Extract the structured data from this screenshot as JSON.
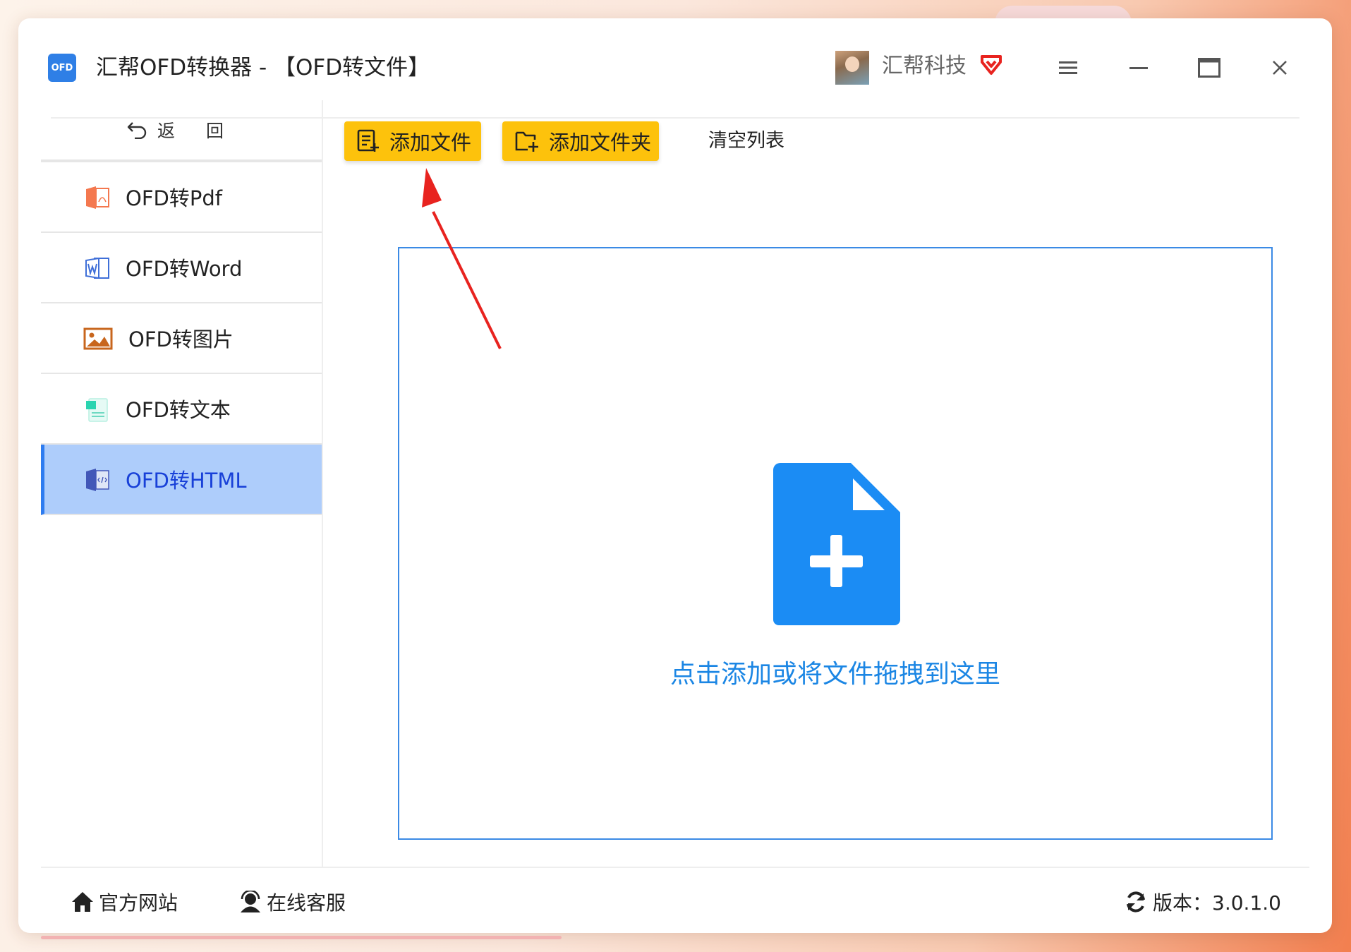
{
  "window": {
    "logo_text": "OFD",
    "title": "汇帮OFD转换器 - 【OFD转文件】",
    "brand": "汇帮科技"
  },
  "sidebar": {
    "back_label": "返 回",
    "items": [
      {
        "label": "OFD转Pdf",
        "icon": "pdf-icon",
        "color": "#f4784f"
      },
      {
        "label": "OFD转Word",
        "icon": "word-icon",
        "color": "#3f6fd8"
      },
      {
        "label": "OFD转图片",
        "icon": "image-icon",
        "color": "#c8661d"
      },
      {
        "label": "OFD转文本",
        "icon": "text-icon",
        "color": "#2ad4b0"
      },
      {
        "label": "OFD转HTML",
        "icon": "html-icon",
        "color": "#4257b8",
        "active": true
      }
    ]
  },
  "toolbar": {
    "add_file_label": "添加文件",
    "add_folder_label": "添加文件夹",
    "clear_list_label": "清空列表"
  },
  "dropzone": {
    "hint": "点击添加或将文件拖拽到这里"
  },
  "footer": {
    "website_label": "官方网站",
    "support_label": "在线客服",
    "version_label": "版本：3.0.1.0"
  },
  "colors": {
    "accent": "#1b86e4",
    "button_yellow": "#fdc20c",
    "active_nav": "#aecdfb",
    "annotation_arrow": "#e8231f"
  }
}
